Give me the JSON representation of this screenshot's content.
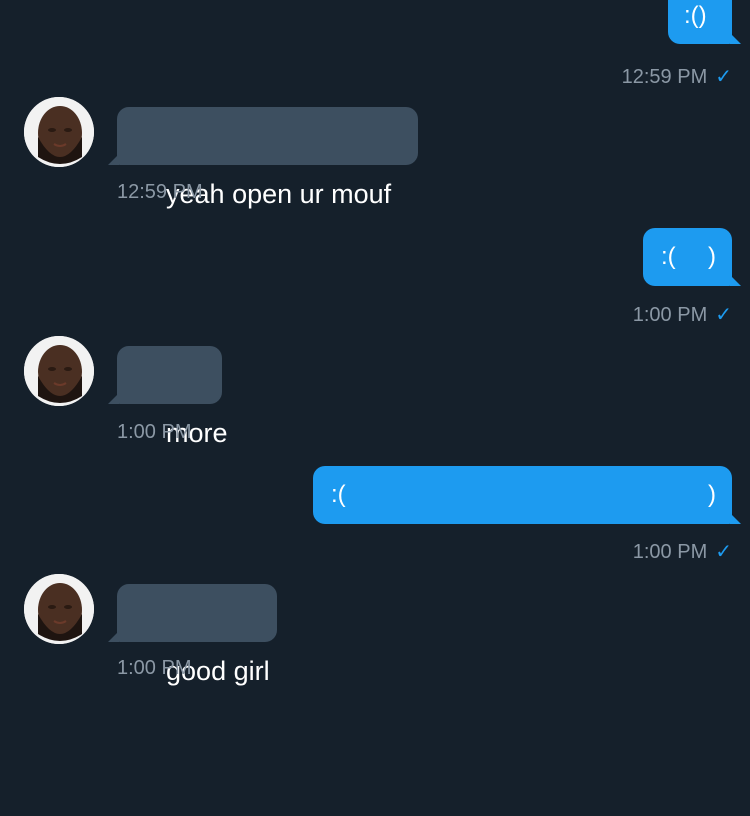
{
  "messages": [
    {
      "id": "m1",
      "direction": "out",
      "text_left": ":()",
      "text_right": "",
      "time": "12:59 PM",
      "read": true
    },
    {
      "id": "m2",
      "direction": "in",
      "text": "yeah open ur mouf",
      "time": "12:59 PM"
    },
    {
      "id": "m3",
      "direction": "out",
      "text_left": ":(",
      "text_right": ")",
      "time": "1:00 PM",
      "read": true
    },
    {
      "id": "m4",
      "direction": "in",
      "text": "more",
      "time": "1:00 PM"
    },
    {
      "id": "m5",
      "direction": "out",
      "text_left": ":(",
      "text_right": ")",
      "time": "1:00 PM",
      "read": true
    },
    {
      "id": "m6",
      "direction": "in",
      "text": "good girl",
      "time": "1:00 PM"
    }
  ],
  "read_receipt_icon": "checkmark-icon",
  "avatar_icon": "user-avatar",
  "colors": {
    "background": "#15202b",
    "outgoing_bubble": "#1d9bf0",
    "incoming_bubble": "#3d4f60",
    "timestamp": "#8b98a5",
    "text": "#ffffff"
  }
}
